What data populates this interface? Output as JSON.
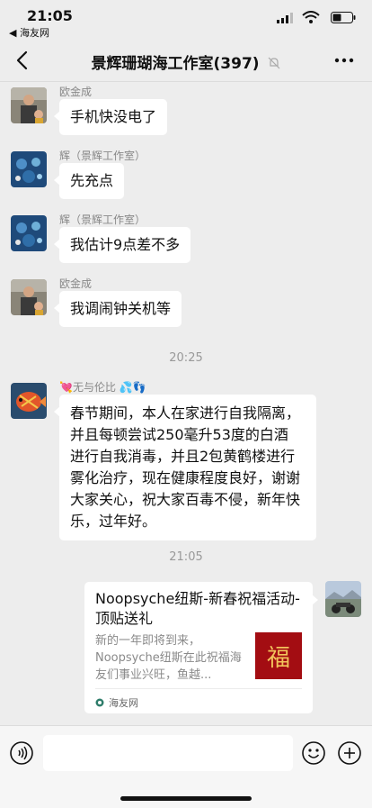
{
  "status": {
    "time": "21:05",
    "back_app": "◀ 海友网"
  },
  "nav": {
    "title": "景辉珊瑚海工作室(397)"
  },
  "messages": [
    {
      "sender": "欧金成",
      "text": "手机快没电了"
    },
    {
      "sender": "辉（景辉工作室）",
      "text": "先充点"
    },
    {
      "sender": "辉（景辉工作室）",
      "text": "我估计9点差不多"
    },
    {
      "sender": "欧金成",
      "text": "我调闹钟关机等"
    },
    {
      "sender": "💘无与伦比 💦👣",
      "text": "春节期间，本人在家进行自我隔离，并且每顿尝试250毫升53度的白酒 进行自我消毒，并且2包黄鹤楼进行雾化治疗，现在健康程度良好，谢谢大家关心，祝大家百毒不侵，新年快乐，过年好。"
    }
  ],
  "timestamps": [
    "20:25",
    "21:05"
  ],
  "card": {
    "title": "Noopsyche纽斯-新春祝福活动-顶贴送礼",
    "description": "新的一年即将到来，Noopsyche纽斯在此祝福海友们事业兴旺，鱼越...",
    "image_text": "福",
    "source": "海友网"
  },
  "input": {
    "value": ""
  },
  "colors": {
    "background": "#ededed",
    "bubble": "#ffffff",
    "card_image": "#a30d12"
  }
}
